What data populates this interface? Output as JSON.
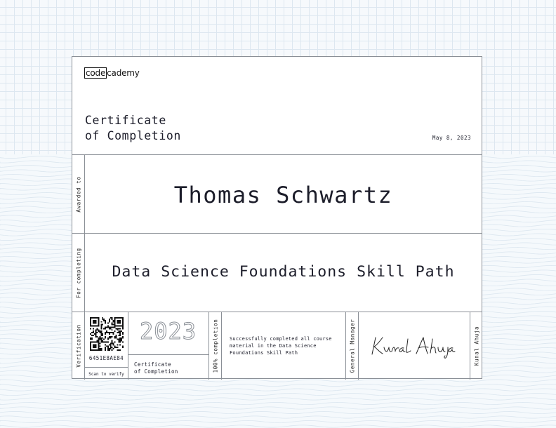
{
  "brand": {
    "logo_box": "code",
    "logo_rest": "cademy"
  },
  "certificate": {
    "title_line1": "Certificate",
    "title_line2": "of Completion",
    "date": "May 8, 2023",
    "awarded_label": "Awarded to",
    "recipient": "Thomas Schwartz",
    "completing_label": "For completing",
    "course": "Data Science Foundations Skill Path"
  },
  "verification": {
    "label": "Verification",
    "code": "6451E8AE84",
    "scan_text": "Scan to verify",
    "year": "2023",
    "sub_line1": "Certificate",
    "sub_line2": "of Completion"
  },
  "completion": {
    "label": "100% completion",
    "description": "Successfully completed all course material in the Data Science Foundations Skill Path"
  },
  "signatory": {
    "role": "General Manager",
    "name": "Kunal Ahuja",
    "signature": "Kunal Ahuja"
  }
}
